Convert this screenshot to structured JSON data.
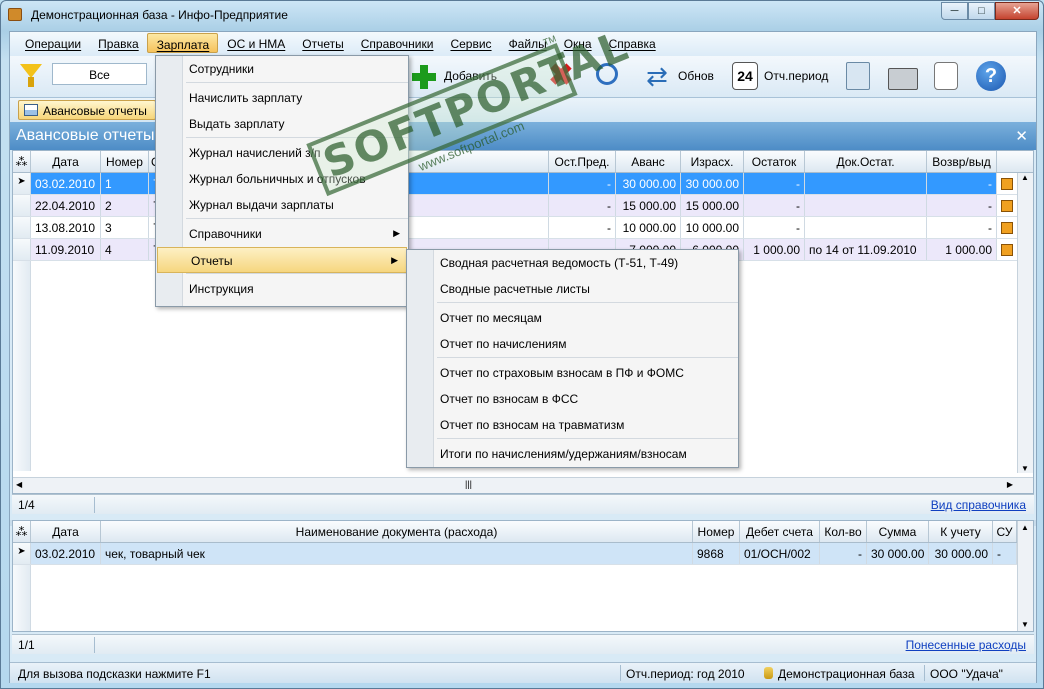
{
  "window": {
    "title": "Демонстрационная база - Инфо-Предприятие"
  },
  "menubar": [
    "Операции",
    "Правка",
    "Зарплата",
    "ОС и НМА",
    "Отчеты",
    "Справочники",
    "Сервис",
    "Файлы",
    "Окна",
    "Справка"
  ],
  "toolbar": {
    "filter_value": "Все",
    "add_label": "Добавить",
    "refresh_label": "Обнов",
    "period_label": "Отч.период",
    "calendar_day": "24"
  },
  "tab": {
    "label": "Авансовые отчеты"
  },
  "panel": {
    "title": "Авансовые отчеты"
  },
  "top_grid": {
    "columns": [
      "Дата",
      "Номер",
      "О",
      "Ост.Пред.",
      "Аванс",
      "Израсх.",
      "Остаток",
      "Док.Остат.",
      "Возвр/выд"
    ],
    "rows": [
      {
        "date": "03.02.2010",
        "num": "1",
        "o": "7",
        "prev": "-",
        "avans": "30 000.00",
        "spent": "30 000.00",
        "rest": "-",
        "doc": "",
        "ret": "-"
      },
      {
        "date": "22.04.2010",
        "num": "2",
        "o": "7",
        "prev": "-",
        "avans": "15 000.00",
        "spent": "15 000.00",
        "rest": "-",
        "doc": "",
        "ret": "-"
      },
      {
        "date": "13.08.2010",
        "num": "3",
        "o": "7",
        "prev": "-",
        "avans": "10 000.00",
        "spent": "10 000.00",
        "rest": "-",
        "doc": "",
        "ret": "-"
      },
      {
        "date": "11.09.2010",
        "num": "4",
        "o": "7",
        "prev": "-",
        "avans": "7 000.00",
        "spent": "6 000.00",
        "rest": "1 000.00",
        "doc": "по 14 от 11.09.2010",
        "ret": "1 000.00"
      }
    ],
    "counter": "1/4",
    "link": "Вид справочника"
  },
  "bottom_grid": {
    "columns": [
      "Дата",
      "Наименование документа (расхода)",
      "Номер",
      "Дебет счета",
      "Кол-во",
      "Сумма",
      "К учету",
      "СУ"
    ],
    "rows": [
      {
        "date": "03.02.2010",
        "name": "чек, товарный чек",
        "num": "9868",
        "debit": "01/ОСН/002",
        "qty": "-",
        "sum": "30 000.00",
        "acc": "30 000.00",
        "su": "-"
      }
    ],
    "counter": "1/1",
    "link": "Понесенные расходы"
  },
  "statusbar": {
    "hint": "Для вызова подсказки нажмите F1",
    "period": "Отч.период: год 2010",
    "database": "Демонстрационная база",
    "company": "ООО \"Удача\""
  },
  "salary_menu": [
    "Сотрудники",
    "Начислить зарплату",
    "Выдать зарплату",
    "Журнал начислений з/п",
    "Журнал больничных и отпусков",
    "Журнал выдачи зарплаты",
    "Справочники",
    "Отчеты",
    "Инструкция"
  ],
  "reports_menu": [
    "Сводная расчетная ведомость (Т-51, Т-49)",
    "Сводные расчетные листы",
    "Отчет по месяцам",
    "Отчет по начислениям",
    "Отчет по страховым взносам в ПФ и ФОМС",
    "Отчет по взносам в ФСС",
    "Отчет по взносам на травматизм",
    "Итоги по начислениям/удержаниям/взносам"
  ],
  "watermark": {
    "text": "SOFTPORTAL",
    "url": "www.softportal.com",
    "tm": "TM"
  }
}
